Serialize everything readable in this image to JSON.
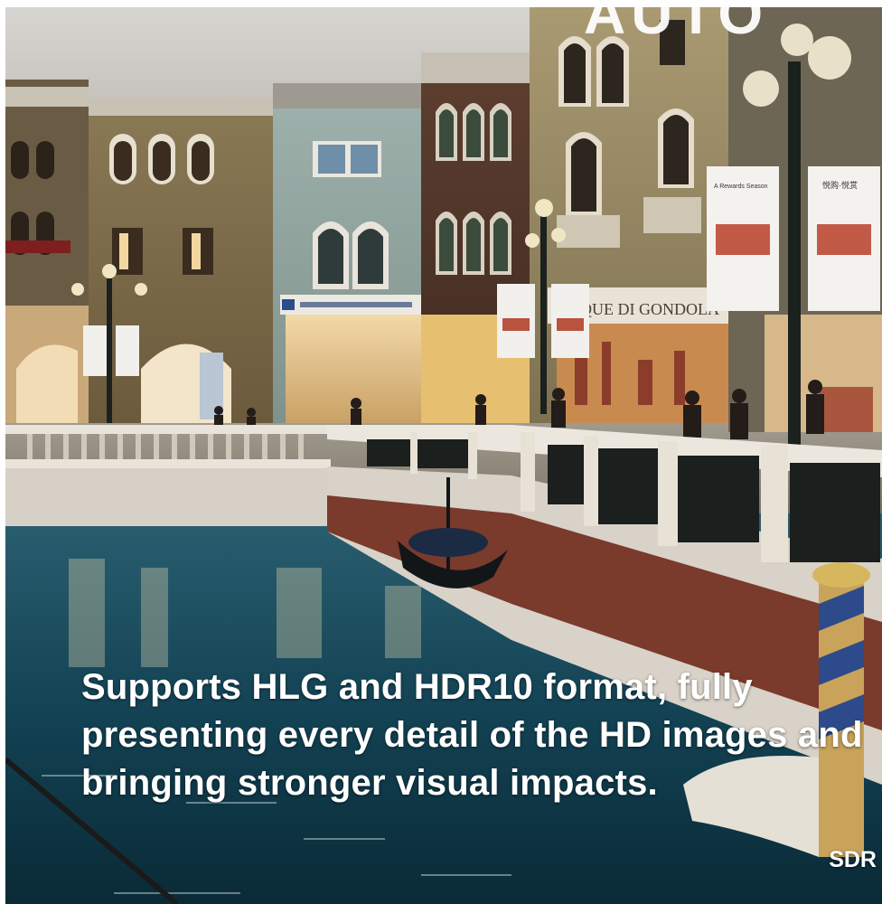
{
  "caption": "Supports HLG and HDR10 format, fully presenting every detail of the HD images and bringing stronger visual impacts.",
  "corner_tag": "SDR",
  "partial_heading": "AUTO",
  "shop_signs": {
    "left_storefront": "",
    "gondola_shop": "UTIQUE DI GONDOLA"
  },
  "banners": {
    "left_small": "A Rewards Season",
    "right_small": "悦购·悦赏"
  },
  "colors": {
    "water": "#0f3a49",
    "stone": "#d8d3ca",
    "brick": "#6e3b2e",
    "text": "#ffffff"
  }
}
